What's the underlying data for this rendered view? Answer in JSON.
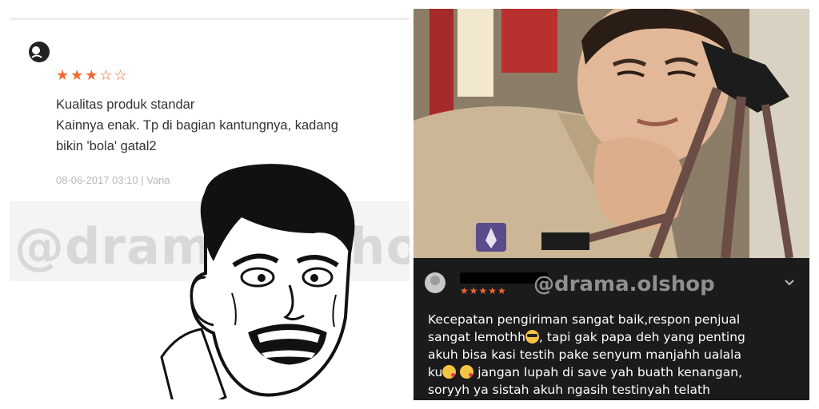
{
  "left_panel": {
    "stars": {
      "filled": "★★★",
      "empty": "☆☆",
      "rating": 3,
      "max": 5
    },
    "review_title": "Kualitas produk standar",
    "review_body_1": "Kainnya enak. Tp di bagian kantungnya, kadang",
    "review_body_2": "bikin 'bola' gatal2",
    "meta": "08-06-2017 03:10  |  Varia",
    "watermark": "@drama.olshop"
  },
  "right_panel": {
    "rating_stars": "★★★★★",
    "watermark": "@drama.olshop",
    "comment": {
      "line1": "Kecepatan pengiriman sangat baik,respon penjual",
      "line2a": "sangat lemothh",
      "line2b": ", tapi gak papa deh yang penting",
      "line3": "akuh bisa kasi testih pake senyum manjahh ualala",
      "line4a": "ku",
      "line4b": " jangan lupah di save yah buath kenangan,",
      "line5": "soryyh ya sistah akuh ngasih testinyah telath"
    }
  },
  "colors": {
    "star": "#ee6a2e",
    "comment_bg": "#1b1b1b"
  },
  "icons": [
    "reviewer-avatar-icon",
    "user-avatar-icon",
    "chevron-down-icon",
    "sunglasses-emoji-icon",
    "kiss-emoji-icon"
  ]
}
